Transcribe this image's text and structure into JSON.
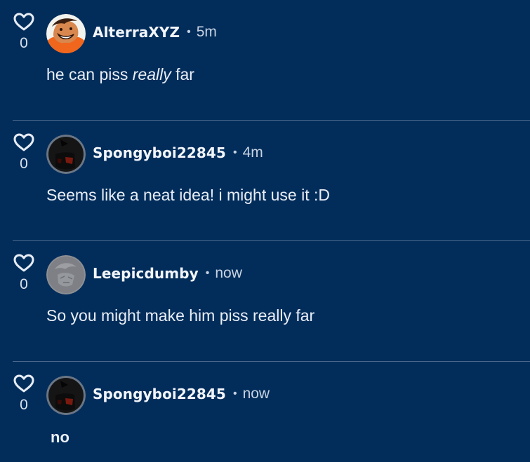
{
  "comments": [
    {
      "likes": "0",
      "username": "AlterraXYZ",
      "separator": "•",
      "time": "5m",
      "text_before": "he can piss ",
      "text_emphasis": "really",
      "text_after": " far"
    },
    {
      "likes": "0",
      "username": "Spongyboi22845",
      "separator": "•",
      "time": "4m",
      "text": "Seems like a neat idea! i might use it :D"
    },
    {
      "likes": "0",
      "username": "Leepicdumby",
      "separator": "•",
      "time": "now",
      "text": "So you might make him piss really far"
    },
    {
      "likes": "0",
      "username": "Spongyboi22845",
      "separator": "•",
      "time": "now",
      "text": "no"
    }
  ],
  "colors": {
    "background": "#022d5b",
    "divider": "#4e6a8d",
    "text": "#e9eef6",
    "muted": "#c8d3e2"
  },
  "icons": {
    "like": "heart-outline-icon"
  }
}
